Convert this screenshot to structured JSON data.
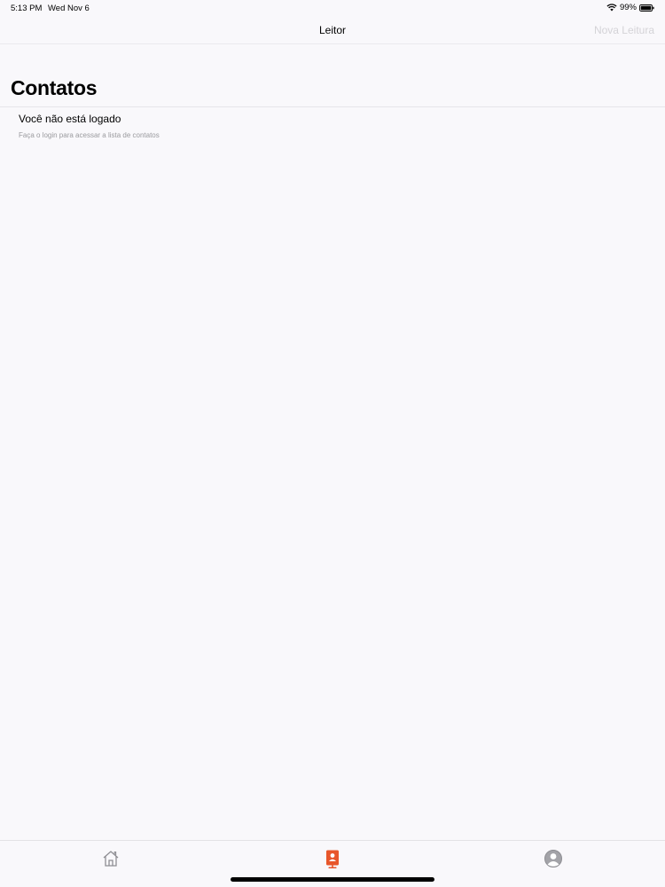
{
  "status_bar": {
    "time": "5:13 PM",
    "date": "Wed Nov 6",
    "battery": "99%"
  },
  "nav": {
    "title": "Leitor",
    "action_label": "Nova Leitura"
  },
  "page": {
    "title": "Contatos"
  },
  "message": {
    "title": "Você não está logado",
    "subtitle": "Faça o login para acessar a lista de contatos"
  },
  "tab_bar": {
    "tabs": [
      {
        "icon": "home-icon",
        "active": false
      },
      {
        "icon": "contacts-icon",
        "active": true
      },
      {
        "icon": "profile-icon",
        "active": false
      }
    ]
  },
  "colors": {
    "accent": "#e8562a",
    "inactive": "#8e8e93",
    "background": "#f9f8fb"
  }
}
